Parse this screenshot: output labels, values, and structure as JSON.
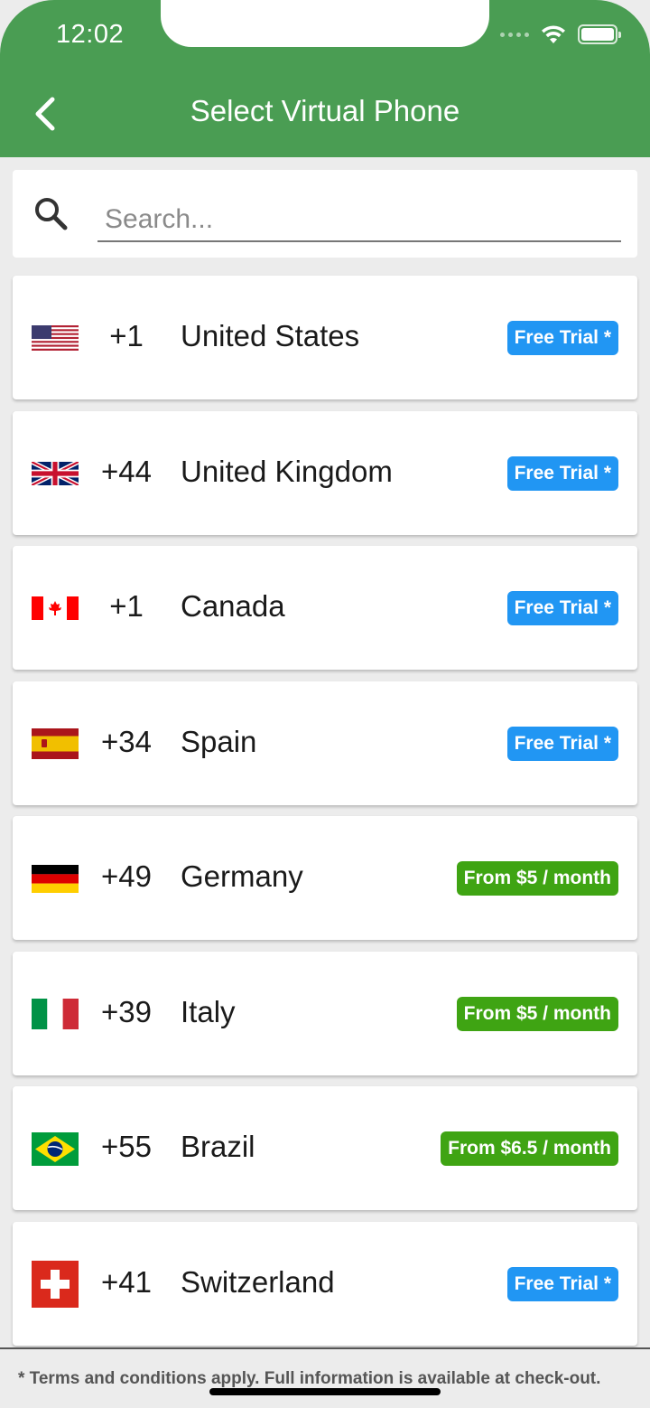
{
  "status_bar": {
    "time": "12:02"
  },
  "header": {
    "title": "Select Virtual Phone",
    "back_icon": "chevron-left-icon"
  },
  "search": {
    "placeholder": "Search...",
    "value": "",
    "icon": "search-icon"
  },
  "countries": [
    {
      "flag": "us-flag-icon",
      "code": "+1",
      "name": "United States",
      "badge": "Free Trial *",
      "badge_color": "#2196f3"
    },
    {
      "flag": "uk-flag-icon",
      "code": "+44",
      "name": "United Kingdom",
      "badge": "Free Trial *",
      "badge_color": "#2196f3"
    },
    {
      "flag": "canada-flag-icon",
      "code": "+1",
      "name": "Canada",
      "badge": "Free Trial *",
      "badge_color": "#2196f3"
    },
    {
      "flag": "spain-flag-icon",
      "code": "+34",
      "name": "Spain",
      "badge": "Free Trial *",
      "badge_color": "#2196f3"
    },
    {
      "flag": "germany-flag-icon",
      "code": "+49",
      "name": "Germany",
      "badge": "From $5 / month",
      "badge_color": "#3fa413"
    },
    {
      "flag": "italy-flag-icon",
      "code": "+39",
      "name": "Italy",
      "badge": "From $5 / month",
      "badge_color": "#3fa413"
    },
    {
      "flag": "brazil-flag-icon",
      "code": "+55",
      "name": "Brazil",
      "badge": "From $6.5 / month",
      "badge_color": "#3fa413"
    },
    {
      "flag": "switzerland-flag-icon",
      "code": "+41",
      "name": "Switzerland",
      "badge": "Free Trial *",
      "badge_color": "#2196f3"
    }
  ],
  "footer": {
    "note": "* Terms and conditions apply. Full information is available at check-out."
  },
  "colors": {
    "header": "#4a9d53",
    "blue_badge": "#2196f3",
    "green_badge": "#3fa413"
  }
}
